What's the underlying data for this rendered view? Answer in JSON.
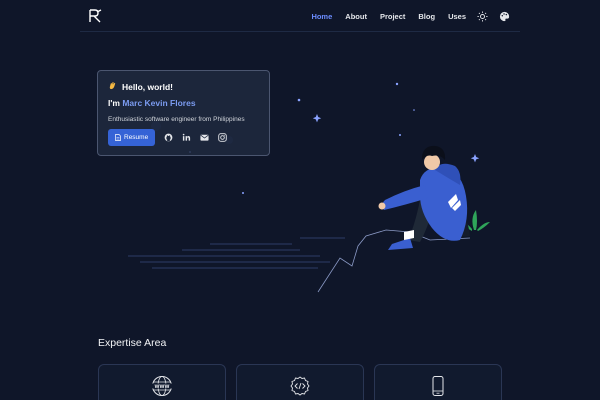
{
  "header": {
    "nav": [
      {
        "label": "Home",
        "active": true
      },
      {
        "label": "About",
        "active": false
      },
      {
        "label": "Project",
        "active": false
      },
      {
        "label": "Blog",
        "active": false
      },
      {
        "label": "Uses",
        "active": false
      }
    ],
    "icons": [
      "logo-icon",
      "sun-icon",
      "palette-icon"
    ]
  },
  "intro": {
    "greeting": "Hello, world!",
    "name_prefix": "I'm",
    "name": "Marc Kevin Flores",
    "tagline": "Enthusiastic software engineer from Philippines",
    "resume_label": "Resume",
    "socials": [
      "github-icon",
      "linkedin-icon",
      "mail-icon",
      "instagram-icon"
    ]
  },
  "expertise": {
    "title": "Expertise Area",
    "cards": [
      "www-icon",
      "code-gear-icon",
      "mobile-icon"
    ]
  },
  "colors": {
    "background": "#0f1629",
    "accent": "#6b8cff",
    "button": "#3563d6",
    "hoodie": "#3a5fd0"
  }
}
